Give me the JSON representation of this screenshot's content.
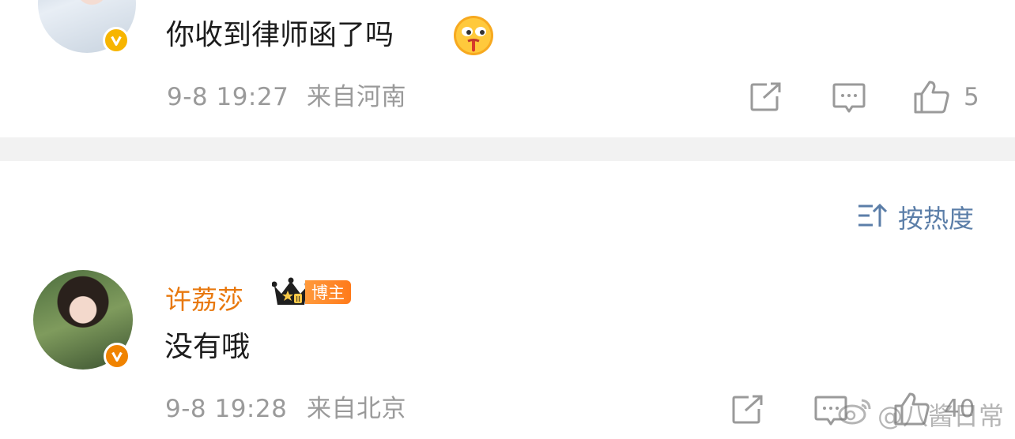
{
  "comment1": {
    "text": "你收到律师函了吗",
    "emoji": "drooling-face-emoji",
    "time": "9-8 19:27",
    "location": "来自河南",
    "likes": "5"
  },
  "sort": {
    "label": "按热度"
  },
  "comment2": {
    "username": "许荔莎",
    "badge_label": "博主",
    "badge_level": "II",
    "text": "没有哦",
    "time": "9-8 19:28",
    "location": "来自北京",
    "likes": "40"
  },
  "watermark": {
    "text": "@八酱日常"
  },
  "colors": {
    "username": "#e8780d",
    "meta": "#9a9a9a",
    "sort": "#5b7ea8",
    "verified": "#f7b500"
  }
}
